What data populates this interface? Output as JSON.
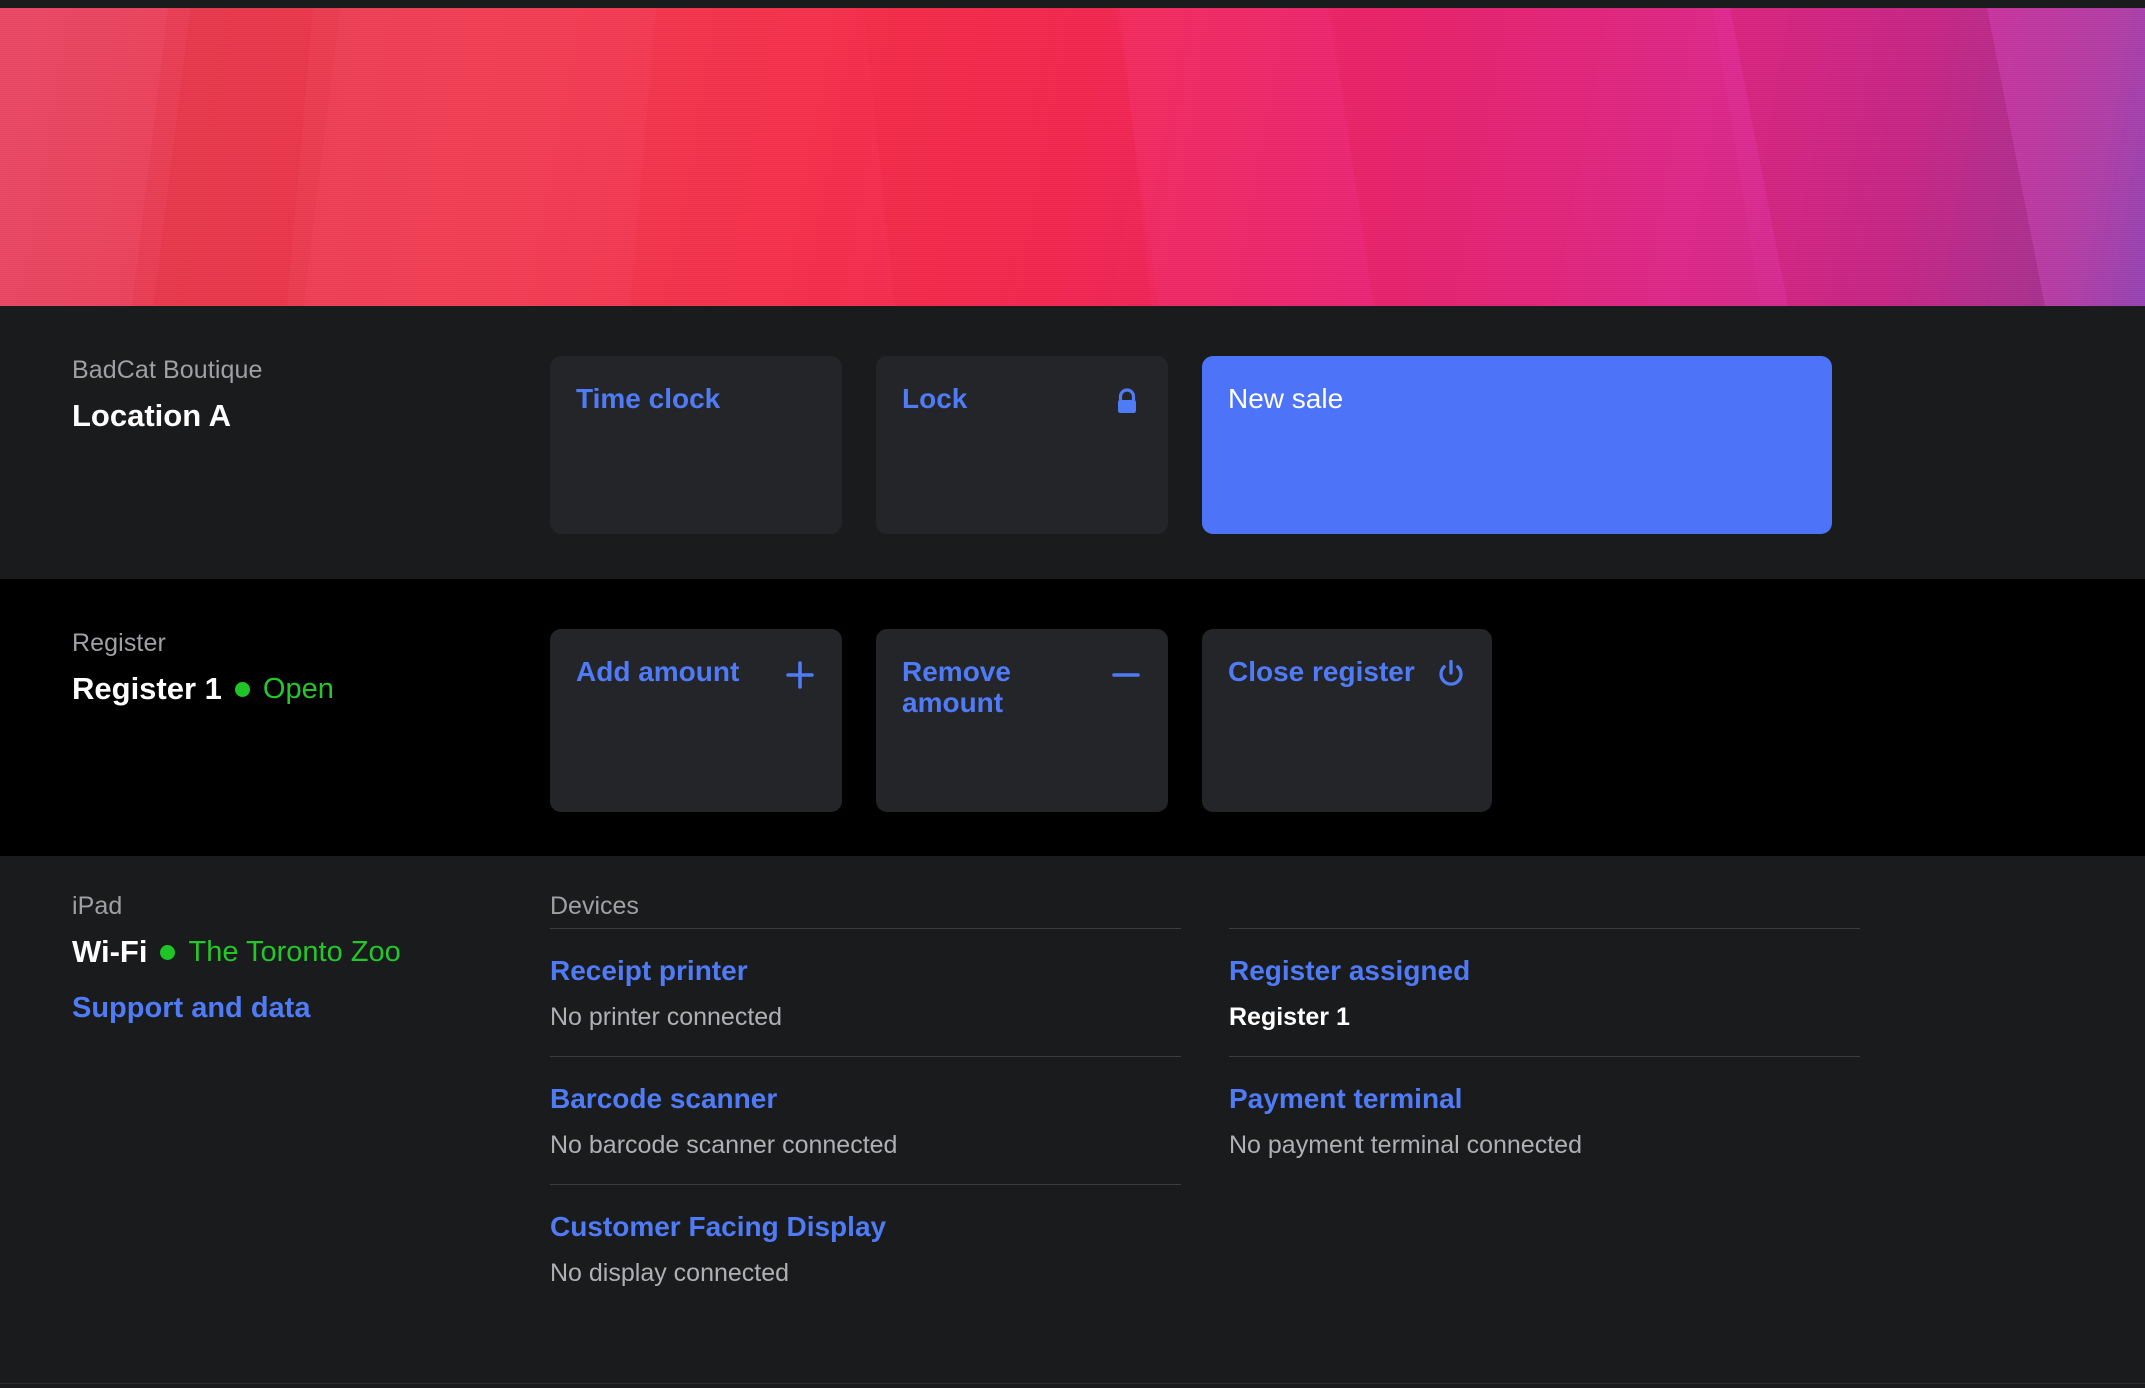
{
  "banner": {
    "name": "decorative-gradient-banner",
    "colors": {
      "left_red": "#e8415c",
      "mid_red": "#f6304c",
      "magenta": "#e02a8e",
      "purple": "#8e3fae"
    }
  },
  "theme": {
    "accent_blue": "#4f7bf7",
    "primary_button_blue": "#4d74f8",
    "status_green": "#25c52c",
    "card_bg": "#242528",
    "section_bg": "#1a1b1d",
    "register_section_bg": "#000000",
    "divider": "#3a3c40"
  },
  "location_section": {
    "label": "BadCat Boutique",
    "value": "Location A",
    "actions": [
      {
        "label": "Time clock",
        "icon": "",
        "style": "secondary"
      },
      {
        "label": "Lock",
        "icon": "lock-icon",
        "style": "secondary"
      },
      {
        "label": "New sale",
        "icon": "",
        "style": "primary"
      }
    ]
  },
  "register_section": {
    "label": "Register",
    "value": "Register 1",
    "status": "Open",
    "status_color": "#25c52c",
    "actions": [
      {
        "label": "Add amount",
        "icon": "plus-icon"
      },
      {
        "label": "Remove amount",
        "icon": "minus-icon"
      },
      {
        "label": "Close register",
        "icon": "power-icon"
      }
    ]
  },
  "device_section": {
    "label": "iPad",
    "connection_label": "Wi-Fi",
    "network_name": "The Toronto Zoo",
    "support_link": "Support and data",
    "columns": [
      {
        "header": "Devices",
        "items": [
          {
            "title": "Receipt printer",
            "sub": "No printer connected",
            "sub_strong": false
          },
          {
            "title": "Barcode scanner",
            "sub": "No barcode scanner connected",
            "sub_strong": false
          },
          {
            "title": "Customer Facing Display",
            "sub": "No display connected",
            "sub_strong": false
          }
        ]
      },
      {
        "header": "",
        "items": [
          {
            "title": "Register assigned",
            "sub": "Register 1",
            "sub_strong": true
          },
          {
            "title": "Payment terminal",
            "sub": "No payment terminal connected",
            "sub_strong": false
          }
        ]
      }
    ]
  }
}
